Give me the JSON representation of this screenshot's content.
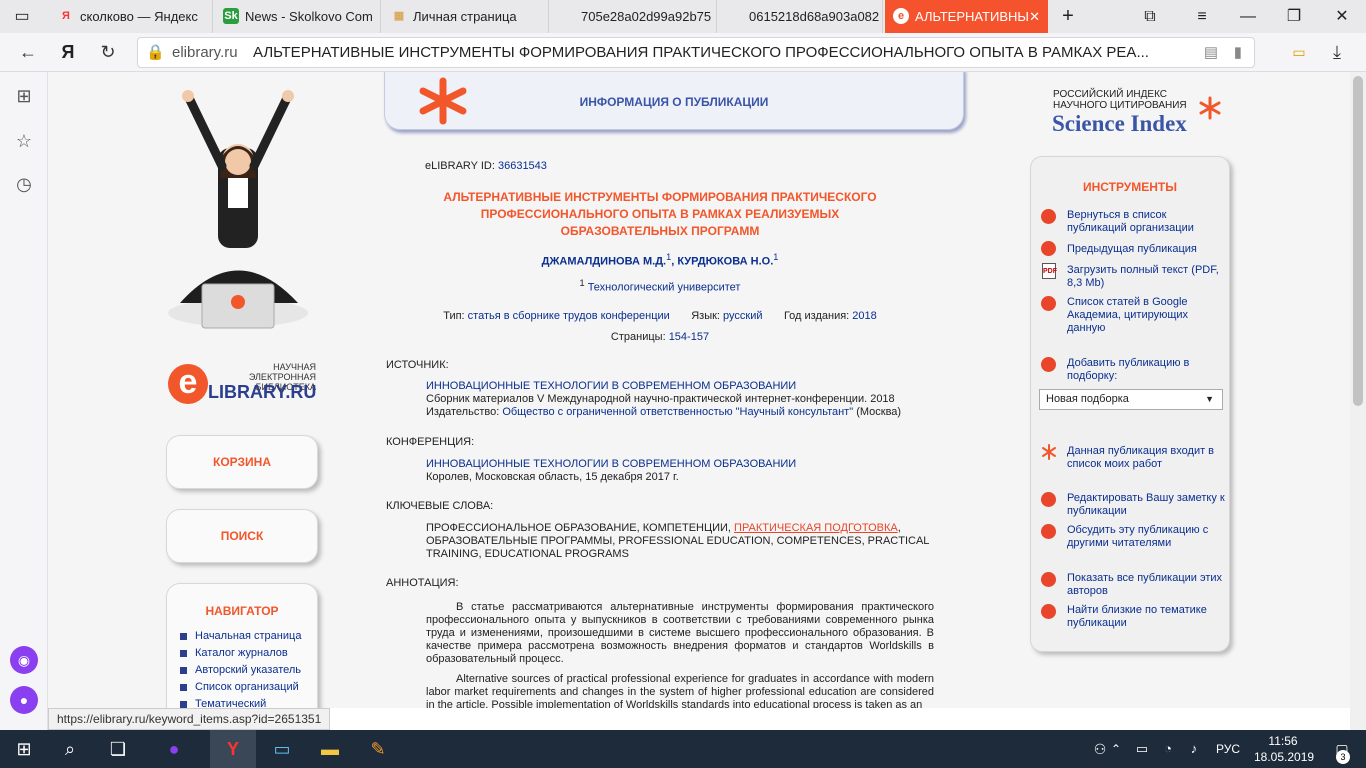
{
  "browser": {
    "tabs": [
      {
        "icon": "Я",
        "icon_color": "#f33",
        "label": "сколково — Яндекс"
      },
      {
        "icon": "Sk",
        "icon_color": "#2a9e3f",
        "label": "News - Skolkovo Com"
      },
      {
        "icon": "▦",
        "icon_color": "#d9a85c",
        "label": "Личная страница"
      },
      {
        "icon": "",
        "icon_color": "#999",
        "label": "705e28a02d99a92b75"
      },
      {
        "icon": "",
        "icon_color": "#999",
        "label": "0615218d68a903a082"
      },
      {
        "icon": "e",
        "icon_color": "#fff",
        "label": "АЛЬТЕРНАТИВНЫ"
      }
    ],
    "yandex_logo": "Я",
    "url_domain": "elibrary.ru",
    "url_title": "АЛЬТЕРНАТИВНЫЕ ИНСТРУМЕНТЫ ФОРМИРОВАНИЯ ПРАКТИЧЕСКОГО ПРОФЕССИОНАЛЬНОГО ОПЫТА В РАМКАХ РЕА...",
    "status_url": "https://elibrary.ru/keyword_items.asp?id=2651351"
  },
  "left": {
    "logo_caption_1": "НАУЧНАЯ ЭЛЕКТРОННАЯ",
    "logo_caption_2": "БИБЛИОТЕКА",
    "logo_text": "LIBRARY.RU",
    "cart": "КОРЗИНА",
    "search": "ПОИСК",
    "nav_title": "НАВИГАТОР",
    "nav_items": [
      "Начальная страница",
      "Каталог журналов",
      "Авторский указатель",
      "Список организаций",
      "Тематический"
    ]
  },
  "header": {
    "title": "ИНФОРМАЦИЯ О ПУБЛИКАЦИИ"
  },
  "pub": {
    "id_label": "eLIBRARY ID:",
    "id": "36631543",
    "title_1": "АЛЬТЕРНАТИВНЫЕ ИНСТРУМЕНТЫ ФОРМИРОВАНИЯ ПРАКТИЧЕСКОГО",
    "title_2": "ПРОФЕССИОНАЛЬНОГО ОПЫТА В РАМКАХ РЕАЛИЗУЕМЫХ",
    "title_3": "ОБРАЗОВАТЕЛЬНЫХ ПРОГРАММ",
    "author_1": "ДЖАМАЛДИНОВА М.Д.",
    "author_2": "КУРДЮКОВА Н.О.",
    "sup": "1",
    "affil": "Технологический университет",
    "type_label": "Тип:",
    "type": "статья в сборнике трудов конференции",
    "lang_label": "Язык:",
    "lang": "русский",
    "year_label": "Год издания:",
    "year": "2018",
    "pages_label": "Страницы:",
    "pages": "154-157",
    "source_label": "ИСТОЧНИК:",
    "source_1": "ИННОВАЦИОННЫЕ ТЕХНОЛОГИИ В СОВРЕМЕННОМ ОБРАЗОВАНИИ",
    "source_2": "Сборник материалов V Международной научно-практической интернет-конференции. 2018",
    "publisher_label": "Издательство:",
    "publisher": "Общество с ограниченной ответственностью \"Научный консультант\"",
    "publisher_city": "(Москва)",
    "conf_label": "КОНФЕРЕНЦИЯ:",
    "conf_1": "ИННОВАЦИОННЫЕ ТЕХНОЛОГИИ В СОВРЕМЕННОМ ОБРАЗОВАНИИ",
    "conf_2": "Королев, Московская область, 15 декабря 2017 г.",
    "kw_label": "КЛЮЧЕВЫЕ СЛОВА:",
    "kw_1": "ПРОФЕССИОНАЛЬНОЕ ОБРАЗОВАНИЕ, КОМПЕТЕНЦИИ, ",
    "kw_hl": "ПРАКТИЧЕСКАЯ ПОДГОТОВКА",
    "kw_2": ", ОБРАЗОВАТЕЛЬНЫЕ ПРОГРАММЫ, PROFESSIONAL EDUCATION, COMPETENCES, PRACTICAL TRAINING, EDUCATIONAL PROGRAMS",
    "abs_label": "АННОТАЦИЯ:",
    "abs_ru": "В статье рассматриваются альтернативные инструменты формирования практического профессионального опыта у выпускников в соответствии с требованиями современного рынка труда и изменениями, произошедшими в системе высшего профессионального образования. В качестве примера рассмотрена возможность внедрения форматов и стандартов Worldskills в образовательный процесс.",
    "abs_en": "Alternative sources of practical professional experience for graduates in accordance with modern labor market requirements and changes in the system of higher professional education are considered in the article. Possible implementation of Worldskills standards into educational process is taken as an"
  },
  "right": {
    "si_1": "РОССИЙСКИЙ ИНДЕКС",
    "si_2": "НАУЧНОГО ЦИТИРОВАНИЯ",
    "si_logo": "Science Index",
    "tools_title": "ИНСТРУМЕНТЫ",
    "t1": "Вернуться в список публикаций организации",
    "t2": "Предыдущая публикация",
    "t3": "Загрузить полный текст (PDF, 8,3 Mb)",
    "t4": "Список статей в Google Академиа, цитирующих данную",
    "t5": "Добавить публикацию в подборку:",
    "select": "Новая подборка",
    "t6": "Данная публикация входит в список моих работ",
    "t7": "Редактировать Вашу заметку к публикации",
    "t8": "Обсудить эту публикацию с другими читателями",
    "t9": "Показать все публикации этих авторов",
    "t10": "Найти близкие по тематике публикации"
  },
  "taskbar": {
    "lang": "РУС",
    "time": "11:56",
    "date": "18.05.2019",
    "notif": "3"
  },
  "colors": {
    "accent": "#f2562b",
    "link": "#0a2f8f",
    "tab_active": "#f4532e"
  }
}
